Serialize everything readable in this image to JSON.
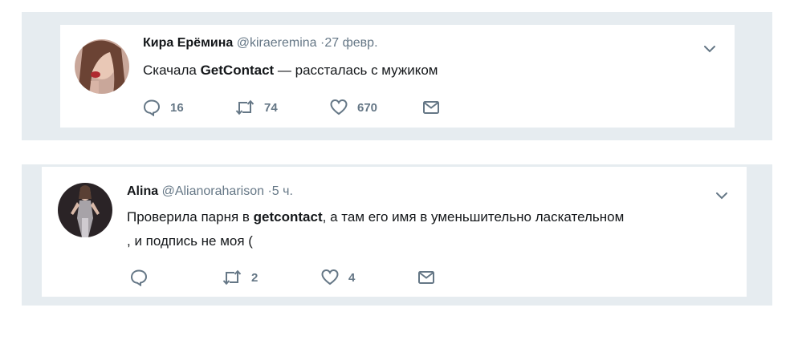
{
  "tweets": [
    {
      "name": "Кира Ерёмина",
      "handle": "@kiraeremina",
      "time": "·27 февр.",
      "text_before": "Скачала ",
      "text_bold": "GetContact",
      "text_after": " — рассталась с мужиком",
      "text_line2": "",
      "actions": {
        "replies": "16",
        "retweets": "74",
        "likes": "670"
      }
    },
    {
      "name": "Alina",
      "handle": "@Alianoraharison",
      "time": "·5 ч.",
      "text_before": "Проверила парня в ",
      "text_bold": "getcontact",
      "text_after": ", а там его имя в уменьшительно ласкательном",
      "text_line2": ", и подпись не моя (",
      "actions": {
        "replies": "",
        "retweets": "2",
        "likes": "4"
      }
    }
  ],
  "icons": {
    "reply": "reply-icon",
    "retweet": "retweet-icon",
    "like": "heart-icon",
    "message": "envelope-icon",
    "more": "chevron-down-icon"
  },
  "colors": {
    "frame": "#e6ecf0",
    "icon": "#657786",
    "text": "#14171a"
  }
}
